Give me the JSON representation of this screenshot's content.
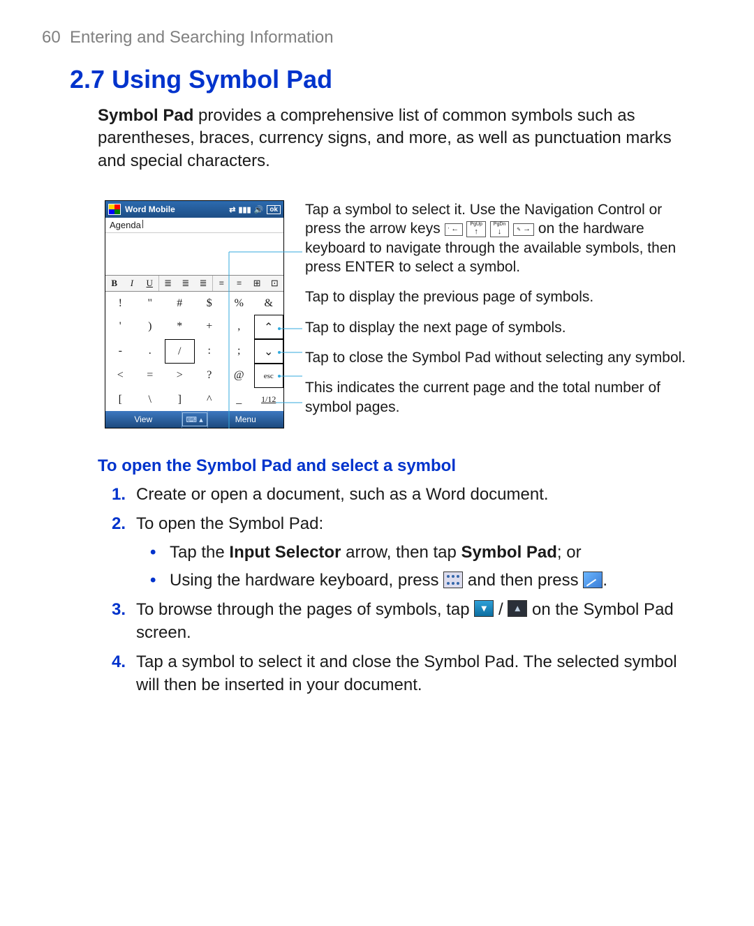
{
  "page_header": {
    "num": "60",
    "chapter": "Entering and Searching Information"
  },
  "section": {
    "num": "2.7",
    "title": "Using Symbol Pad"
  },
  "intro": {
    "b": "Symbol Pad",
    "rest": " provides a comprehensive list of common symbols such as parentheses, braces, currency signs, and more, as well as punctuation marks and special characters."
  },
  "device": {
    "title": "Word Mobile",
    "ok": "ok",
    "agenda": "Agenda",
    "toolbar": [
      "B",
      "I",
      "U",
      "≣",
      "≣",
      "≣",
      "≡",
      "≡",
      "⊞",
      "⊡"
    ],
    "symbols_rows": [
      [
        "!",
        "\"",
        "#",
        "$",
        "%",
        "&"
      ],
      [
        "'",
        ")",
        "*",
        "+",
        ",",
        "⌃"
      ],
      [
        "-",
        ".",
        "/",
        ":",
        ";",
        "⌄"
      ],
      [
        "<",
        "=",
        ">",
        "?",
        "@",
        "esc"
      ],
      [
        "[",
        "\\",
        "]",
        "^",
        "_",
        "1/12"
      ]
    ],
    "footer_left": "View",
    "footer_right": "Menu"
  },
  "callouts": {
    "c1a": "Tap a symbol to select it. Use the Navigation Control or press the arrow keys ",
    "c1b_on": "on",
    "c1c": " the hardware keyboard to navigate through the available symbols, then press ENTER to select a symbol.",
    "c2": "Tap to display the previous page of symbols.",
    "c3": "Tap to display the next page of symbols.",
    "c4": "Tap to close the Symbol Pad without selecting any symbol.",
    "c5": "This indicates the current page and the total number of symbol pages."
  },
  "arrow_keys": {
    "left": "←",
    "pgup_label": "PgUp",
    "pgup_arrow": "↑",
    "pgdn_label": "PgDn",
    "pgdn_arrow": "↓",
    "right": "→"
  },
  "subhead": "To open the Symbol Pad and select a symbol",
  "steps": {
    "s1_num": "1.",
    "s1_text": "Create or open a document, such as a Word document.",
    "s2_num": "2.",
    "s2_text": "To open the Symbol Pad:",
    "s2_b1_a": "Tap the ",
    "s2_b1_b": "Input Selector",
    "s2_b1_c": " arrow, then tap ",
    "s2_b1_d": "Symbol Pad",
    "s2_b1_e": "; or",
    "s2_b2_a": "Using the hardware keyboard, press ",
    "s2_b2_b": " and then press ",
    "s2_b2_c": ".",
    "s3_num": "3.",
    "s3_a": "To browse through the pages of symbols, tap ",
    "s3_sep": " / ",
    "s3_b": " on the Symbol Pad screen.",
    "s4_num": "4.",
    "s4_text": "Tap a symbol to select it and close the Symbol Pad. The selected symbol will then be inserted in your document."
  },
  "glyphs": {
    "down": "▾",
    "up": "▴"
  }
}
